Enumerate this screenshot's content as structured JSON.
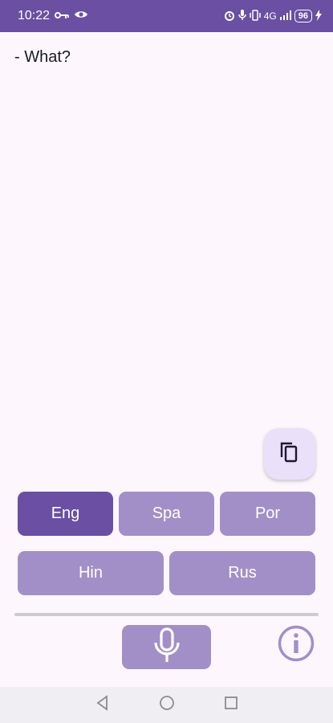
{
  "status_bar": {
    "time": "10:22",
    "network": "4G",
    "battery": "96"
  },
  "transcript": {
    "text": "- What?"
  },
  "languages": {
    "row1": [
      {
        "label": "Eng",
        "active": true
      },
      {
        "label": "Spa",
        "active": false
      },
      {
        "label": "Por",
        "active": false
      }
    ],
    "row2": [
      {
        "label": "Hin",
        "active": false
      },
      {
        "label": "Rus",
        "active": false
      }
    ]
  },
  "icons": {
    "copy": "copy-icon",
    "mic": "microphone-icon",
    "info": "info-icon"
  },
  "colors": {
    "primary": "#6a4fa3",
    "button": "#a28fc7",
    "fab": "#ebe0f9",
    "background": "#fdf7fd"
  }
}
